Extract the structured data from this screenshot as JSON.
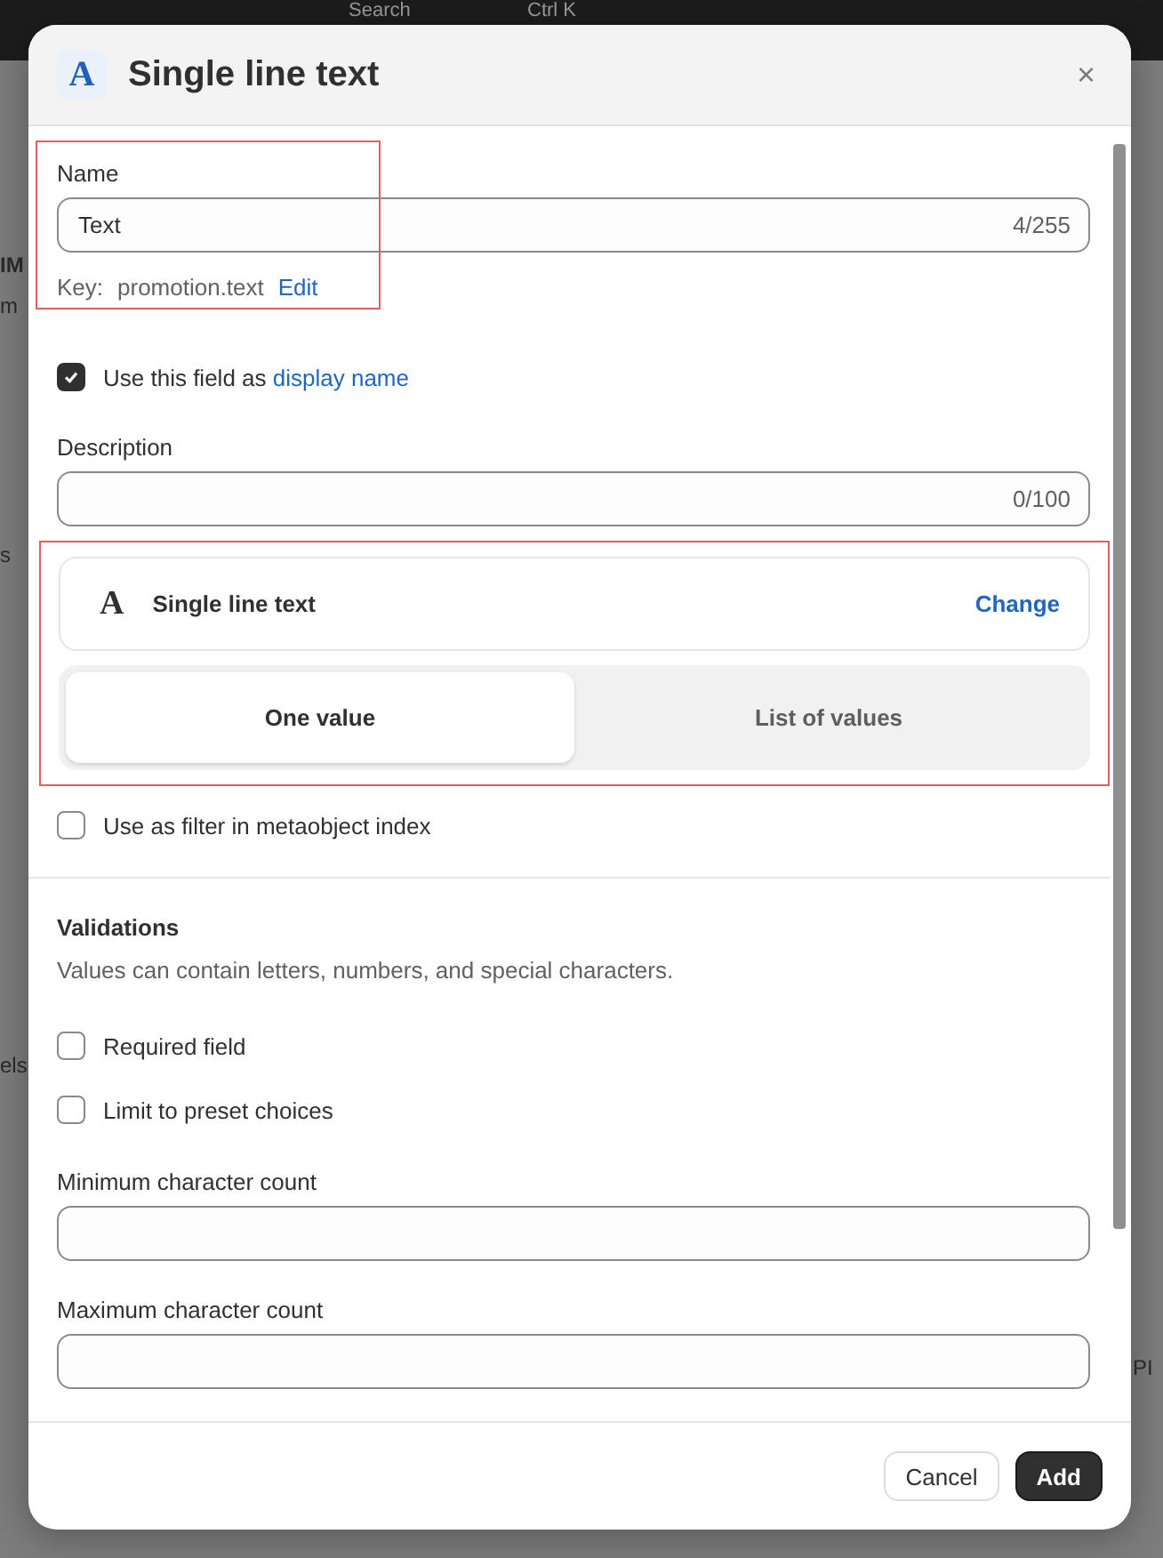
{
  "backdrop": {
    "search": "Search",
    "shortcut": "Ctrl K",
    "fragments_left": [
      "IM",
      "m",
      "s",
      "els"
    ],
    "fragments_right": [
      "PI"
    ]
  },
  "dialog": {
    "icon": "A",
    "title": "Single line text",
    "close": "×"
  },
  "name_field": {
    "label": "Name",
    "value": "Text",
    "counter": "4/255",
    "key_label": "Key:",
    "key_value": "promotion.text",
    "edit_link": "Edit",
    "highlighted": true
  },
  "display_name_option": {
    "text": "Use this field as",
    "link": "display name",
    "checked": true
  },
  "description_field": {
    "label": "Description",
    "counter": "0/100"
  },
  "type_card": {
    "icon": "A",
    "name": "Single line text",
    "change_link": "Change",
    "highlighted": true
  },
  "value_modes": [
    {
      "label": "One value",
      "selected": true
    },
    {
      "label": "List of values",
      "selected": false
    }
  ],
  "filter_option": {
    "label": "Use as filter in metaobject index",
    "checked": false
  },
  "validations": {
    "title": "Validations",
    "description": "Values can contain letters, numbers, and special characters.",
    "options": [
      {
        "label": "Required field",
        "checked": false
      },
      {
        "label": "Limit to preset choices",
        "checked": false
      }
    ],
    "fields": [
      {
        "label": "Minimum character count"
      },
      {
        "label": "Maximum character count"
      }
    ]
  },
  "footer": {
    "buttons": [
      {
        "label": "Cancel",
        "kind": "secondary"
      },
      {
        "label": "Add",
        "kind": "primary"
      }
    ]
  }
}
